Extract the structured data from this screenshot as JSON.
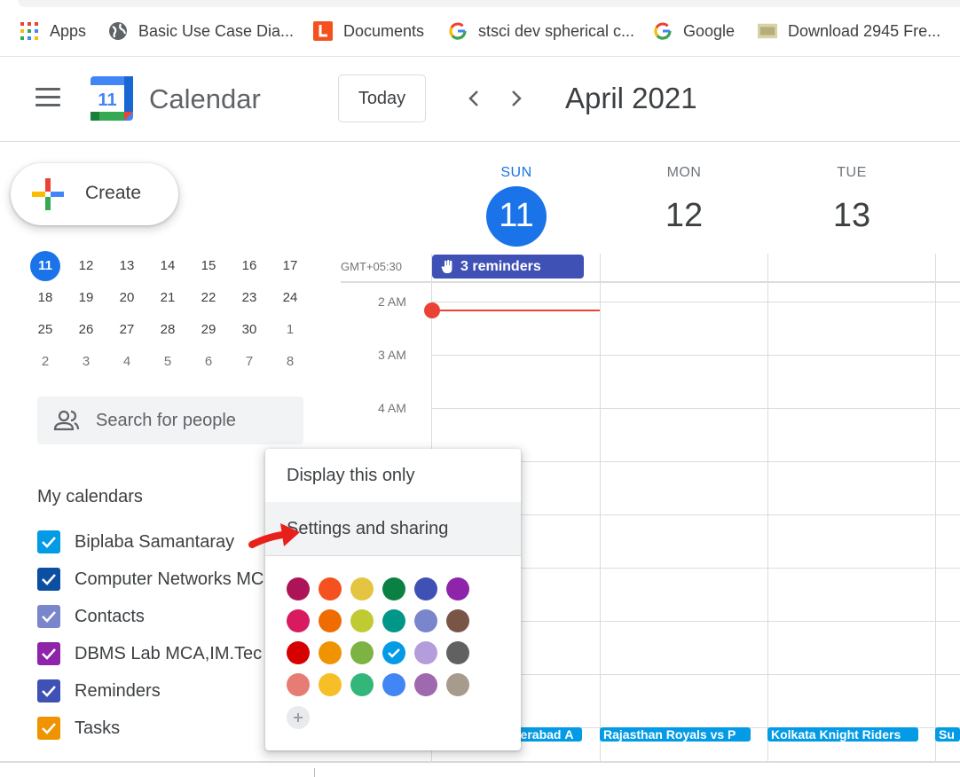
{
  "bookmarks": [
    {
      "label": "Apps",
      "icon": "apps-grid-icon"
    },
    {
      "label": "Basic Use Case Dia...",
      "icon": "globe-icon"
    },
    {
      "label": "Documents",
      "icon": "documents-icon"
    },
    {
      "label": "stsci dev spherical c...",
      "icon": "google-g-icon"
    },
    {
      "label": "Google",
      "icon": "google-g-icon"
    },
    {
      "label": "Download 2945 Fre...",
      "icon": "css-icon"
    }
  ],
  "header": {
    "app_title": "Calendar",
    "logo_day": "11",
    "today_label": "Today",
    "month_title": "April 2021"
  },
  "create_label": "Create",
  "days": [
    {
      "dow": "SUN",
      "num": "11",
      "today": true
    },
    {
      "dow": "MON",
      "num": "12",
      "today": false
    },
    {
      "dow": "TUE",
      "num": "13",
      "today": false
    }
  ],
  "mini_calendar": {
    "rows": [
      [
        "11",
        "12",
        "13",
        "14",
        "15",
        "16",
        "17"
      ],
      [
        "18",
        "19",
        "20",
        "21",
        "22",
        "23",
        "24"
      ],
      [
        "25",
        "26",
        "27",
        "28",
        "29",
        "30",
        "1"
      ],
      [
        "2",
        "3",
        "4",
        "5",
        "6",
        "7",
        "8"
      ]
    ],
    "selected": "11"
  },
  "search_people_placeholder": "Search for people",
  "my_calendars": {
    "title": "My calendars",
    "items": [
      {
        "label": "Biplaba Samantaray",
        "color": "#039be5"
      },
      {
        "label": "Computer Networks MC",
        "color": "#0b4ea2"
      },
      {
        "label": "Contacts",
        "color": "#7986cb"
      },
      {
        "label": "DBMS Lab MCA,IM.Tec",
        "color": "#8e24aa"
      },
      {
        "label": "Reminders",
        "color": "#3f51b5"
      },
      {
        "label": "Tasks",
        "color": "#f09300"
      }
    ]
  },
  "grid": {
    "timezone": "GMT+05:30",
    "hours": [
      "2 AM",
      "3 AM",
      "4 AM"
    ],
    "reminders_chip": "3 reminders",
    "bottom_events": [
      "derabad А",
      "Rajasthan Royals vs P",
      "Kolkata Knight Riders",
      "Su"
    ]
  },
  "menu": {
    "items": [
      "Display this only",
      "Settings and sharing"
    ],
    "colors": [
      [
        "#ad1457",
        "#f4511e",
        "#e4c441",
        "#0b8043",
        "#3f51b5",
        "#8e24aa"
      ],
      [
        "#d81b60",
        "#ef6c00",
        "#c0ca33",
        "#009688",
        "#7986cb",
        "#795548"
      ],
      [
        "#d50000",
        "#f09300",
        "#7cb342",
        "#039be5",
        "#b39ddb",
        "#616161"
      ],
      [
        "#e67c73",
        "#f6bf26",
        "#33b679",
        "#4285f4",
        "#9e69af",
        "#a79b8e"
      ]
    ],
    "selected_color": "#039be5"
  }
}
